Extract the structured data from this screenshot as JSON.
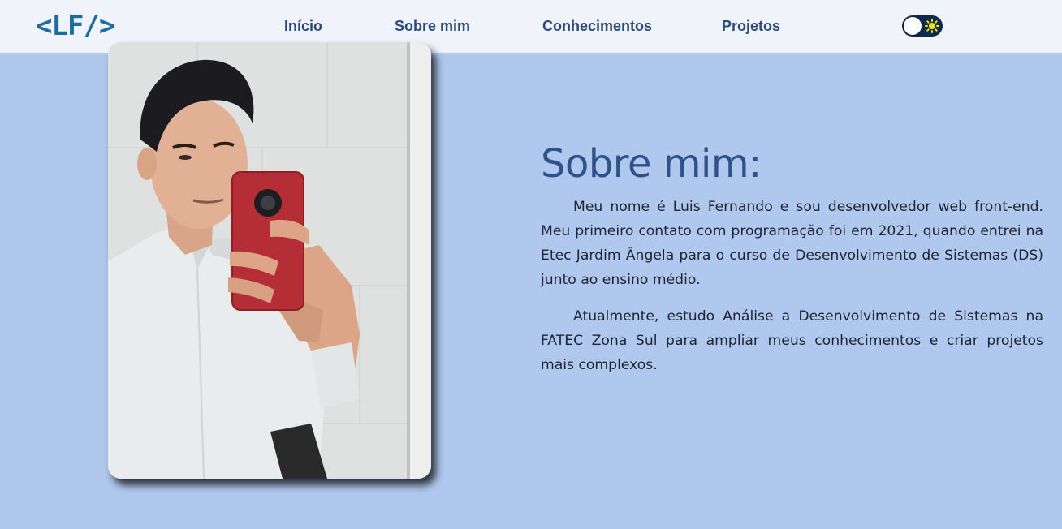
{
  "header": {
    "logo": "<LF/>",
    "nav": [
      {
        "label": "Início"
      },
      {
        "label": "Sobre mim"
      },
      {
        "label": "Conhecimentos"
      },
      {
        "label": "Projetos"
      }
    ],
    "theme_toggle": {
      "icon": "sun-icon",
      "state": "light"
    }
  },
  "about": {
    "photo_icon": "profile-photo",
    "title": "Sobre mim:",
    "paragraphs": [
      "Meu nome é Luis Fernando e sou desenvolvedor web front-end. Meu primeiro contato com programação foi em 2021, quando entrei na Etec Jardim Ângela para o curso de Desenvolvimento de Sistemas (DS) junto ao ensino médio.",
      "Atualmente, estudo Análise a Desenvolvimento de Sistemas na FATEC Zona Sul para ampliar meus conhecimentos e criar projetos mais complexos."
    ]
  },
  "colors": {
    "background": "#b0c8ee",
    "navbar": "#f0f3fa",
    "logo": "#1a6fa0",
    "nav_text": "#2c4a7a",
    "title": "#2f5388",
    "toggle": "#0b2a4e",
    "sun": "#f2e600"
  }
}
